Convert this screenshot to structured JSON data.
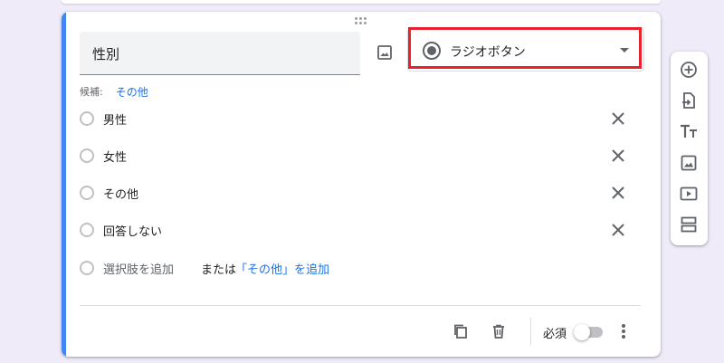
{
  "question": {
    "title": "性別",
    "type_label": "ラジオボタン",
    "suggestion_label": "候補:",
    "suggestion_chip": "その他",
    "options": [
      {
        "label": "男性"
      },
      {
        "label": "女性"
      },
      {
        "label": "その他"
      },
      {
        "label": "回答しない"
      }
    ],
    "add_option_label": "選択肢を追加",
    "or_label": "または",
    "add_other_label": "「その他」を追加"
  },
  "footer": {
    "required_label": "必須",
    "required_on": false
  },
  "colors": {
    "accent": "#4285f4",
    "link": "#1a73e8",
    "highlight": "#e8212b",
    "background": "#f0ebf8"
  },
  "icons": {
    "title_image": "image-icon",
    "type_radio": "radio-button-checked-icon",
    "dropdown": "arrow-drop-down-icon",
    "option_delete": "close-icon",
    "duplicate": "copy-icon",
    "delete": "trash-icon",
    "more": "more-vert-icon",
    "toolbar": [
      "add-circle-icon",
      "import-icon",
      "title-text-icon",
      "image-icon",
      "video-icon",
      "section-icon"
    ]
  }
}
